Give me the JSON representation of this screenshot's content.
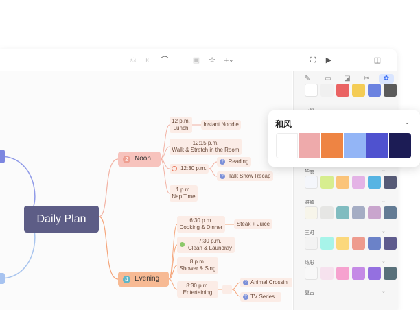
{
  "toolbar": {
    "icons": [
      "undo-icon",
      "redo-icon",
      "curve-icon",
      "branch-icon",
      "topic-icon",
      "star-icon",
      "add-icon",
      "fullscreen-icon",
      "play-icon",
      "panel-toggle-icon"
    ],
    "add_label": "+",
    "add_chevron": "⌄"
  },
  "panel": {
    "tabs": [
      "brush-icon",
      "image-icon",
      "sticker-icon",
      "scissors-icon",
      "palette-icon"
    ],
    "sections": [
      {
        "label": "水粉"
      },
      {
        "label": "华丽"
      },
      {
        "label": "雅致"
      },
      {
        "label": "三时"
      },
      {
        "label": "炫彩"
      },
      {
        "label": "复古"
      }
    ],
    "top_colors": [
      "#ffffff",
      "#f0f0f0",
      "#ea6363",
      "#f4cc55",
      "#6b82e0",
      "#5a5a5a"
    ],
    "row_colors": [
      [
        "#f4f6fb",
        "#d7ee8f",
        "#fbc47a",
        "#e4b3e6",
        "#56b4e3",
        "#565a76"
      ],
      [
        "#f7f5ea",
        "#e6e6e4",
        "#80bcc0",
        "#a5adc4",
        "#c9a5cd",
        "#637b94"
      ],
      [
        "#f3f3f3",
        "#a7f4e9",
        "#fbd87c",
        "#ee9b8e",
        "#6b82c8",
        "#5e5b8d"
      ],
      [
        "#f8f8f8",
        "#f6e2ee",
        "#f6a2cf",
        "#c58ae6",
        "#9470e0",
        "#58707a"
      ]
    ]
  },
  "popup": {
    "title": "和风",
    "colors": [
      "#ffffff",
      "#eeaaab",
      "#ee8443",
      "#93b5f6",
      "#4f52cf",
      "#1c1c55"
    ]
  },
  "mindmap": {
    "root": "Daily Plan",
    "noon": {
      "label": "Noon",
      "num": "2"
    },
    "evening": {
      "label": "Evening",
      "num": "4"
    },
    "noon_items": {
      "i1": [
        "12 p.m.",
        "Lunch"
      ],
      "i1_child": "Instant Noodle",
      "i2": [
        "12:15 p.m.",
        "Walk & Stretch in the Room"
      ],
      "i3": "12:30 p.m.",
      "i3_children": [
        "Reading",
        "Talk Show Recap"
      ],
      "i4": [
        "1 p.m.",
        "Nap Time"
      ]
    },
    "evening_items": {
      "e1": [
        "6:30 p.m.",
        "Cooking & Dinner"
      ],
      "e1_child": "Steak + Juice",
      "e2": [
        "7:30 p.m.",
        "Clean & Laundray"
      ],
      "e3": [
        "8 p.m.",
        "Shower & Sing"
      ],
      "e4": [
        "8:30 p.m.",
        "Entertaining"
      ],
      "e4_children": [
        "Animal Crossin",
        "TV Series"
      ]
    },
    "colors": {
      "noon_line": "#f2b2a3",
      "evening_line": "#f5a57a",
      "left_line": "#8f9ae8",
      "root": "#5d5d86",
      "noon_fill": "#f7c3bd",
      "evening_fill": "#f7ba94"
    }
  }
}
